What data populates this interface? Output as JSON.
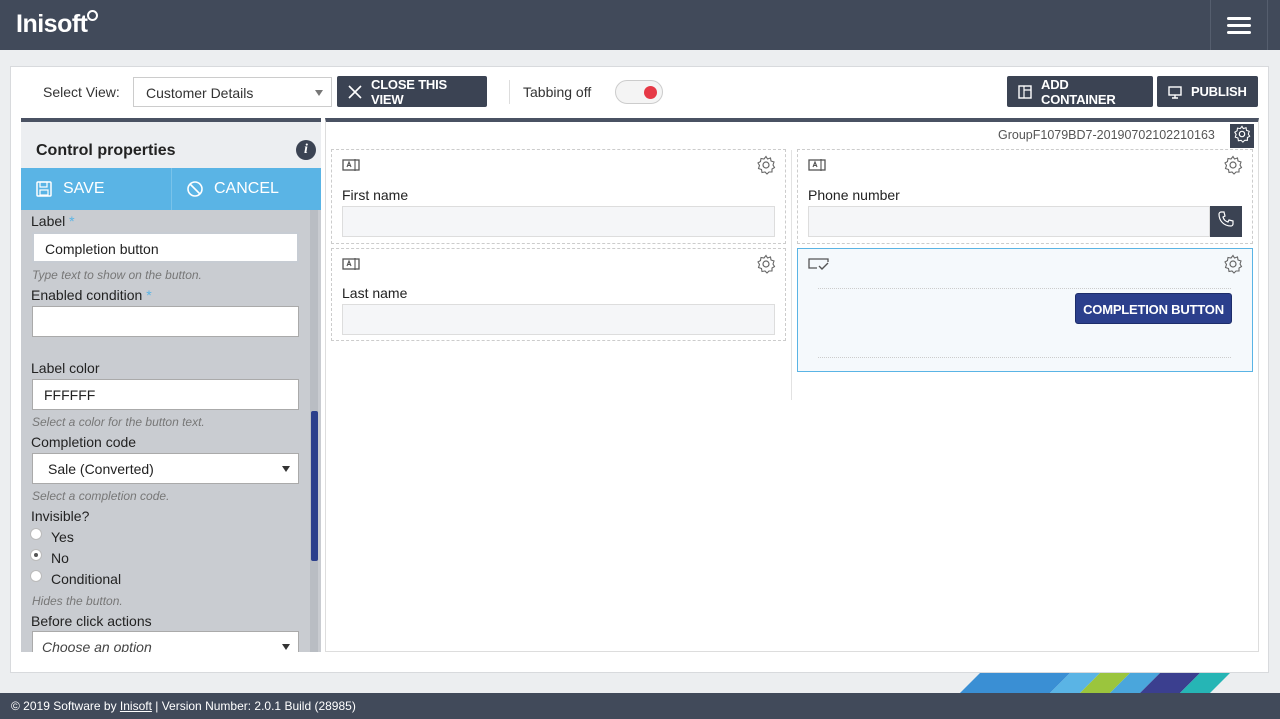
{
  "app": {
    "logo": "Inisoft"
  },
  "toolbar": {
    "select_view_label": "Select View:",
    "select_view_value": "Customer Details",
    "close_view_label": "CLOSE THIS VIEW",
    "tabbing_label": "Tabbing off",
    "add_container_label": "ADD CONTAINER",
    "publish_label": "PUBLISH"
  },
  "panel": {
    "title": "Control properties",
    "save_label": "SAVE",
    "cancel_label": "CANCEL",
    "fields": {
      "label": {
        "label": "Label",
        "required": "*",
        "value": "Completion button",
        "help": "Type text to show on the button."
      },
      "enabled_condition": {
        "label": "Enabled condition",
        "required": "*",
        "value": ""
      },
      "label_color": {
        "label": "Label color",
        "value": "FFFFFF",
        "help": "Select a color for the button text."
      },
      "completion_code": {
        "label": "Completion code",
        "value": "Sale (Converted)",
        "help": "Select a completion code."
      },
      "invisible": {
        "label": "Invisible?",
        "options": [
          "Yes",
          "No",
          "Conditional"
        ],
        "selected": "No",
        "help": "Hides the button."
      },
      "before_click": {
        "label": "Before click actions",
        "placeholder": "Choose an option"
      }
    }
  },
  "canvas": {
    "group_id": "GroupF1079BD7-20190702102210163",
    "controls": {
      "first_name": "First name",
      "last_name": "Last name",
      "phone_number": "Phone number",
      "completion_button": "COMPLETION BUTTON"
    }
  },
  "footer": {
    "prefix": "© 2019 Software by ",
    "link": "Inisoft",
    "suffix": " | Version Number: 2.0.1 Build (28985)"
  },
  "colors": {
    "topbar": "#414a5a",
    "accent": "#5ab4e5",
    "button_dark": "#3b4353",
    "completion_button": "#2b3f8c",
    "toggle_off": "#e63946"
  },
  "icons": [
    "menu-icon",
    "close-icon",
    "container-icon",
    "monitor-icon",
    "info-icon",
    "save-icon",
    "cancel-icon",
    "gear-icon",
    "textbox-icon",
    "button-icon",
    "phone-icon"
  ]
}
